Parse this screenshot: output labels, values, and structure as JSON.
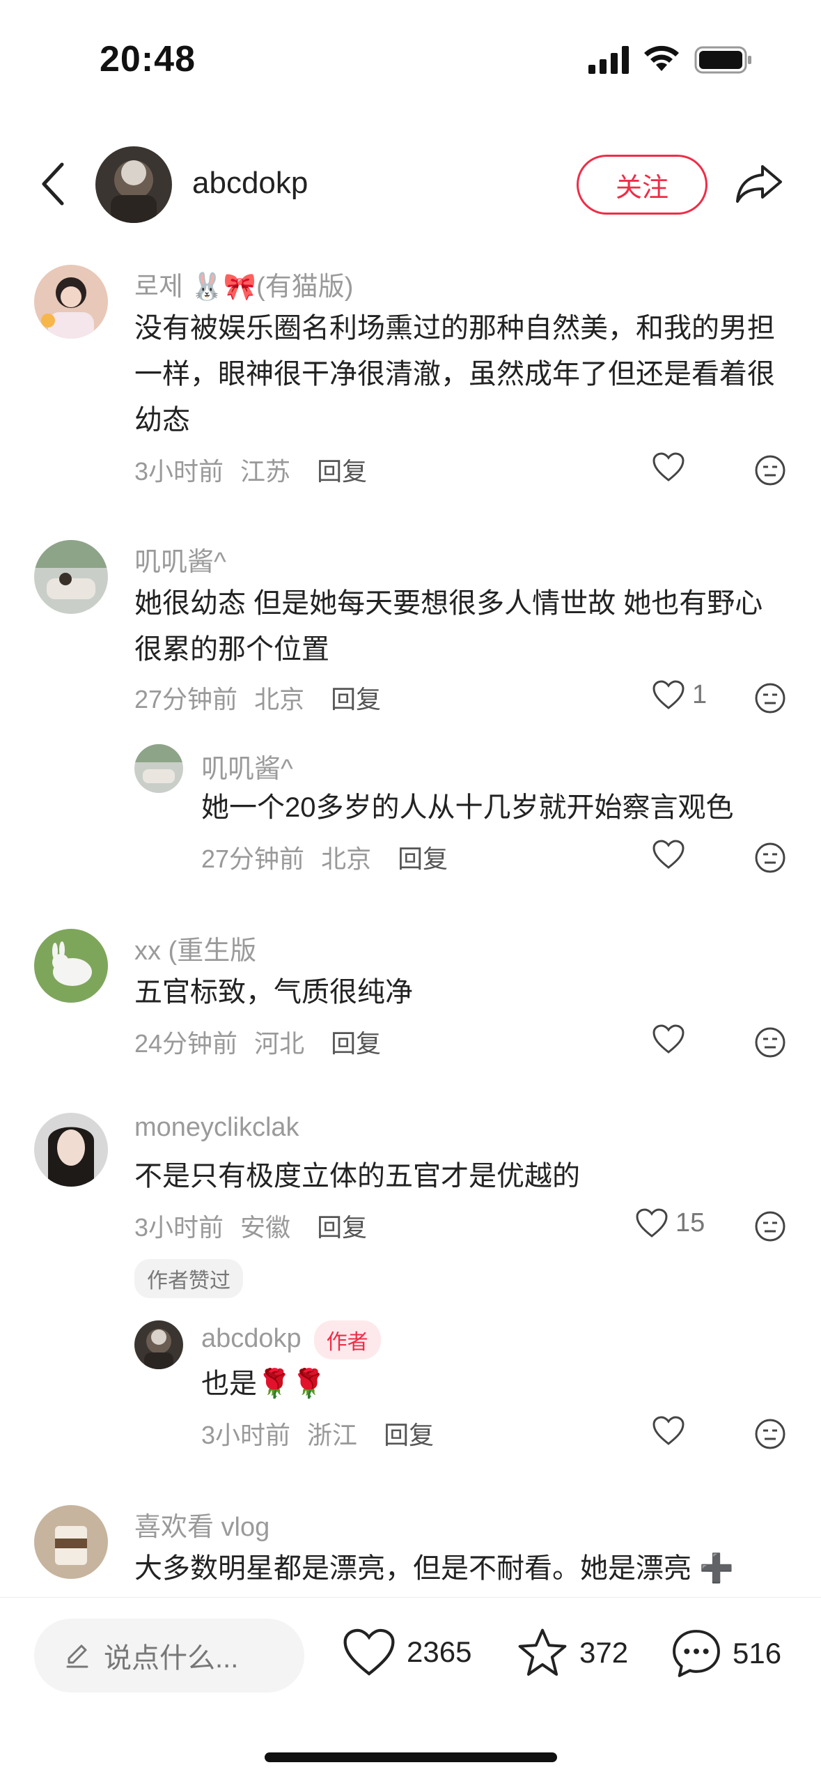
{
  "status_bar": {
    "time": "20:48"
  },
  "header": {
    "username": "abcdokp",
    "follow_label": "关注"
  },
  "comments": [
    {
      "user": "로제 🐰🎀(有猫版)",
      "text": "没有被娱乐圈名利场熏过的那种自然美，和我的男担一样，眼神很干净很清澈，虽然成年了但还是看着很幼态",
      "time": "3小时前",
      "location": "江苏",
      "reply_label": "回复",
      "likes": ""
    },
    {
      "user": "叽叽酱^",
      "text": "她很幼态 但是她每天要想很多人情世故 她也有野心 很累的那个位置",
      "time": "27分钟前",
      "location": "北京",
      "reply_label": "回复",
      "likes": "1",
      "replies": [
        {
          "user": "叽叽酱^",
          "text": "她一个20多岁的人从十几岁就开始察言观色",
          "time": "27分钟前",
          "location": "北京",
          "reply_label": "回复"
        }
      ]
    },
    {
      "user": "xx (重生版",
      "text": "五官标致，气质很纯净",
      "time": "24分钟前",
      "location": "河北",
      "reply_label": "回复",
      "likes": ""
    },
    {
      "user": "moneyclikclak",
      "text": "不是只有极度立体的五官才是优越的",
      "time": "3小时前",
      "location": "安徽",
      "reply_label": "回复",
      "likes": "15",
      "tag": "作者赞过",
      "replies": [
        {
          "user": "abcdokp",
          "badge": "作者",
          "text": "也是🌹🌹",
          "time": "3小时前",
          "location": "浙江",
          "reply_label": "回复"
        }
      ]
    },
    {
      "user": "喜欢看 vlog",
      "text": "大多数明星都是漂亮，但是不耐看。她是漂亮 ➕"
    }
  ],
  "bottom_bar": {
    "input_placeholder": "说点什么...",
    "like_count": "2365",
    "star_count": "372",
    "comment_count": "516"
  }
}
